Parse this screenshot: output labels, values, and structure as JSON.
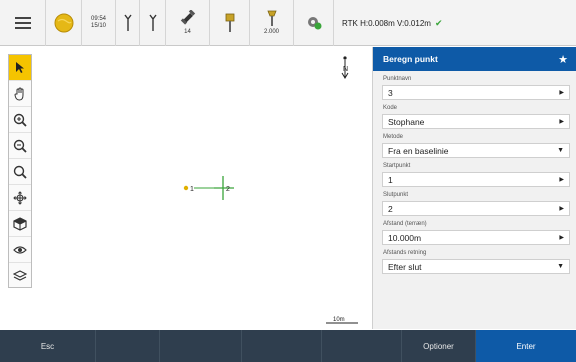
{
  "status_bar": {
    "time": "09:54",
    "date": "15/10",
    "satellites_count": "14",
    "antenna_height": "2.000",
    "rtk_text": "RTK H:0.008m V:0.012m"
  },
  "map": {
    "point_1_label": "1",
    "point_2_label": "2",
    "north_label": "N",
    "scale_label": "10m"
  },
  "panel": {
    "title": "Beregn punkt",
    "fields": [
      {
        "label": "Punktnavn",
        "value": "3"
      },
      {
        "label": "Kode",
        "value": "Stophane"
      },
      {
        "label": "Metode",
        "value": "Fra en baselinie"
      },
      {
        "label": "Startpunkt",
        "value": "1"
      },
      {
        "label": "Slutpunkt",
        "value": "2"
      },
      {
        "label": "Afstand (terræn)",
        "value": "10.000m"
      },
      {
        "label": "Afstands retning",
        "value": "Efter slut"
      }
    ]
  },
  "bottom_bar": {
    "esc_label": "Esc",
    "options_label": "Optioner",
    "enter_label": "Enter"
  },
  "colors": {
    "accent": "#0e5aa7",
    "active_tool": "#f5c400",
    "bottom_bar": "#2f3e4e",
    "map_line": "#3aa53a"
  }
}
